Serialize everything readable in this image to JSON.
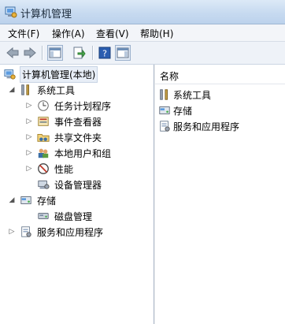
{
  "window": {
    "title": "计算机管理"
  },
  "menu": [
    "文件(F)",
    "操作(A)",
    "查看(V)",
    "帮助(H)"
  ],
  "toolbar": {
    "icons": [
      "back-arrow-icon",
      "forward-arrow-icon",
      "show-hide-console-tree-icon",
      "export-list-icon",
      "help-icon",
      "show-hide-action-pane-icon"
    ]
  },
  "tree": {
    "root": "计算机管理(本地)",
    "system_tools": "系统工具",
    "task_scheduler": "任务计划程序",
    "event_viewer": "事件查看器",
    "shared_folders": "共享文件夹",
    "local_users_groups": "本地用户和组",
    "performance": "性能",
    "device_manager": "设备管理器",
    "storage": "存储",
    "disk_management": "磁盘管理",
    "services_apps": "服务和应用程序"
  },
  "details": {
    "column_name": "名称",
    "items": [
      "系统工具",
      "存储",
      "服务和应用程序"
    ]
  },
  "colors": {
    "titlebar": "#c7daf0",
    "selection": "#e8eef7"
  }
}
